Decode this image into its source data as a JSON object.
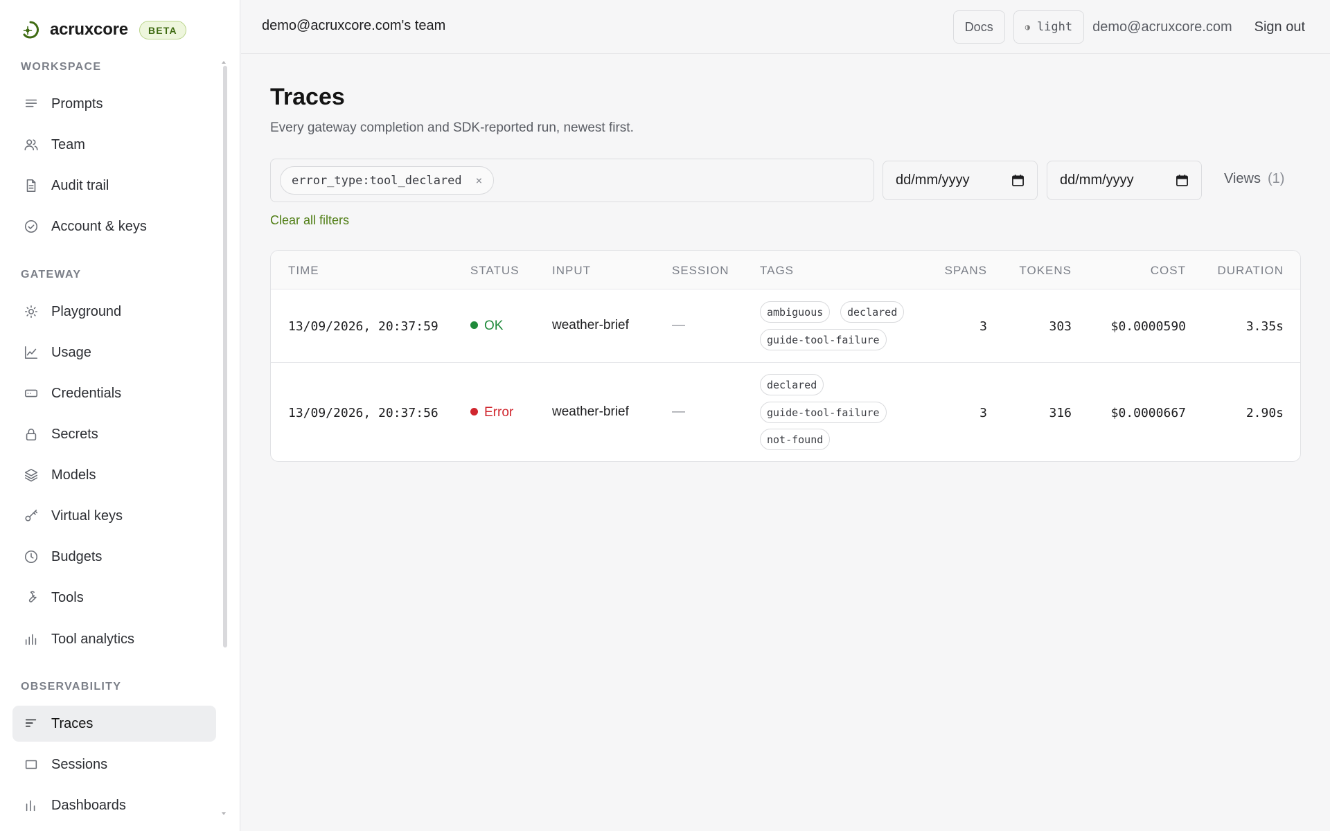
{
  "brand": {
    "name": "acruxcore",
    "badge": "BETA"
  },
  "sidebar": {
    "sections": [
      {
        "label": "WORKSPACE",
        "items": [
          {
            "label": "Prompts",
            "icon": "list-icon"
          },
          {
            "label": "Team",
            "icon": "users-icon"
          },
          {
            "label": "Audit trail",
            "icon": "file-icon"
          },
          {
            "label": "Account & keys",
            "icon": "check-circle-icon"
          }
        ]
      },
      {
        "label": "GATEWAY",
        "items": [
          {
            "label": "Playground",
            "icon": "sun-icon"
          },
          {
            "label": "Usage",
            "icon": "line-chart-icon"
          },
          {
            "label": "Credentials",
            "icon": "card-icon"
          },
          {
            "label": "Secrets",
            "icon": "lock-icon"
          },
          {
            "label": "Models",
            "icon": "layers-icon"
          },
          {
            "label": "Virtual keys",
            "icon": "key-icon"
          },
          {
            "label": "Budgets",
            "icon": "clock-icon"
          },
          {
            "label": "Tools",
            "icon": "wrench-icon"
          },
          {
            "label": "Tool analytics",
            "icon": "bar-chart-icon"
          }
        ]
      },
      {
        "label": "OBSERVABILITY",
        "items": [
          {
            "label": "Traces",
            "icon": "traces-icon",
            "active": true
          },
          {
            "label": "Sessions",
            "icon": "square-icon"
          },
          {
            "label": "Dashboards",
            "icon": "bars-icon"
          }
        ]
      }
    ]
  },
  "topbar": {
    "team": "demo@acruxcore.com's team",
    "docs": "Docs",
    "theme_glyph": "◑",
    "theme": "light",
    "user": "demo@acruxcore.com",
    "signout": "Sign out"
  },
  "page": {
    "title": "Traces",
    "subtitle": "Every gateway completion and SDK-reported run, newest first.",
    "filter_chip": "error_type:tool_declared",
    "chip_close": "×",
    "date_from": "dd/mm/yyyy",
    "date_to": "dd/mm/yyyy",
    "views_label": "Views",
    "views_count": "(1)",
    "clear_filters": "Clear all filters"
  },
  "table": {
    "columns": [
      "TIME",
      "STATUS",
      "INPUT",
      "SESSION",
      "TAGS",
      "SPANS",
      "TOKENS",
      "COST",
      "DURATION"
    ],
    "rows": [
      {
        "time": "13/09/2026, 20:37:59",
        "status": "OK",
        "status_color": "#1f8a3a",
        "input": "weather-brief",
        "session": "—",
        "tags": [
          "ambiguous",
          "declared",
          "guide-tool-failure"
        ],
        "spans": "3",
        "tokens": "303",
        "cost": "$0.0000590",
        "duration": "3.35s"
      },
      {
        "time": "13/09/2026, 20:37:56",
        "status": "Error",
        "status_color": "#d0262e",
        "input": "weather-brief",
        "session": "—",
        "tags": [
          "declared",
          "guide-tool-failure",
          "not-found"
        ],
        "spans": "3",
        "tokens": "316",
        "cost": "$0.0000667",
        "duration": "2.90s"
      }
    ]
  },
  "colors": {
    "accent": "#4f7d14",
    "ok": "#1f8a3a",
    "error": "#d0262e"
  }
}
